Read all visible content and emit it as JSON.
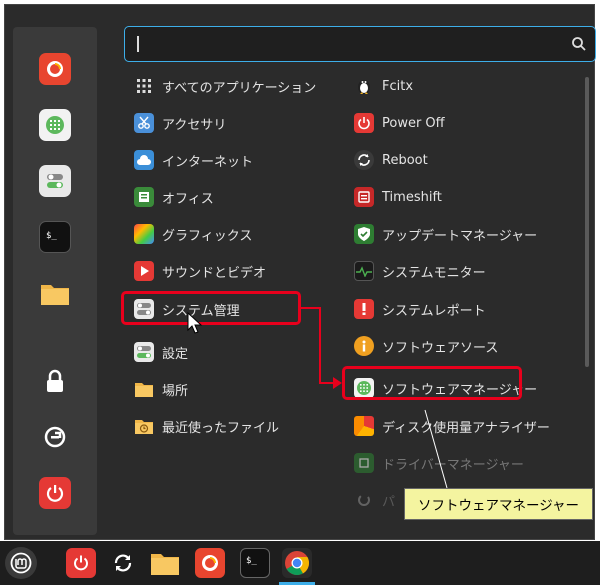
{
  "search": {
    "value": "",
    "placeholder": ""
  },
  "left_items": [
    "すべてのアプリケーション",
    "アクセサリ",
    "インターネット",
    "オフィス",
    "グラフィックス",
    "サウンドとビデオ",
    "システム管理",
    "設定",
    "場所",
    "最近使ったファイル"
  ],
  "right_items": [
    "Fcitx",
    "Power Off",
    "Reboot",
    "Timeshift",
    "アップデートマネージャー",
    "システムモニター",
    "システムレポート",
    "ソフトウェアソース",
    "ソフトウェアマネージャー",
    "ディスク使用量アナライザー",
    "ドライバーマネージャー",
    "パ"
  ],
  "callout": {
    "label": "ソフトウェアマネージャー"
  },
  "colors": {
    "accent": "#3daee9",
    "highlight": "#e8001c",
    "callout_bg": "#f4f4a0"
  }
}
